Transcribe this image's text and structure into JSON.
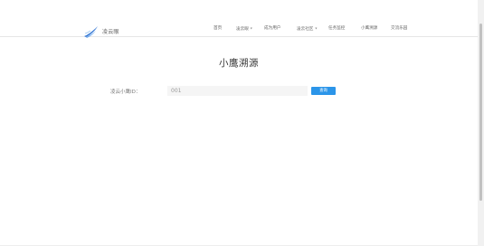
{
  "header": {
    "logo_text": "凌云眼",
    "nav": [
      {
        "label": "首页",
        "has_caret": false
      },
      {
        "label": "凌云眼",
        "has_caret": true
      },
      {
        "label": "成为用户",
        "has_caret": false
      },
      {
        "label": "凌云社区",
        "has_caret": true
      },
      {
        "label": "任务监控",
        "has_caret": false
      },
      {
        "label": "小鹰溯源",
        "has_caret": false
      },
      {
        "label": "交流乐园",
        "has_caret": false
      }
    ]
  },
  "main": {
    "title": "小鹰溯源",
    "search": {
      "label": "凌云小鹰ID：",
      "value": "001",
      "button_label": "查询"
    }
  },
  "colors": {
    "accent": "#2b95e9",
    "logo_blue": "#3a7bd5",
    "input_bg": "#f5f5f5"
  }
}
